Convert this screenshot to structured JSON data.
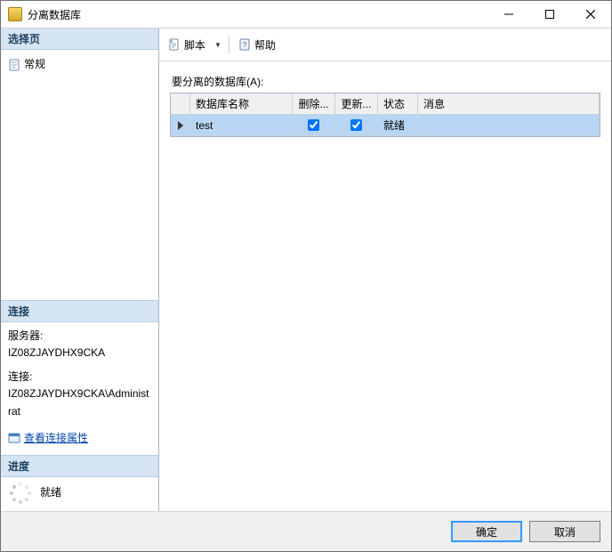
{
  "window": {
    "title": "分离数据库"
  },
  "left": {
    "select_page_header": "选择页",
    "general_page_label": "常规",
    "connection_header": "连接",
    "server_label": "服务器:",
    "server_value": "IZ08ZJAYDHX9CKA",
    "conn_label": "连接:",
    "conn_value": "IZ08ZJAYDHX9CKA\\Administrat",
    "view_conn_props": "查看连接属性",
    "progress_header": "进度",
    "progress_status": "就绪"
  },
  "toolbar": {
    "script_label": "脚本",
    "help_label": "帮助"
  },
  "main": {
    "prompt": "要分离的数据库(A):",
    "columns": {
      "name": "数据库名称",
      "delete": "删除...",
      "update": "更新...",
      "status": "状态",
      "message": "消息"
    },
    "rows": [
      {
        "name": "test",
        "delete": true,
        "update": true,
        "status": "就绪",
        "message": ""
      }
    ]
  },
  "footer": {
    "ok": "确定",
    "cancel": "取消"
  }
}
